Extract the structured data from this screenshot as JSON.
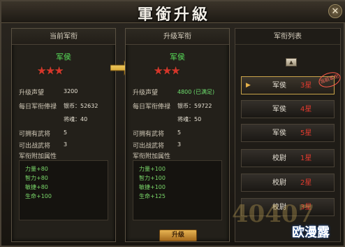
{
  "window": {
    "title": "軍銜升級",
    "close_glyph": "✕"
  },
  "current": {
    "header": "当前军衔",
    "rank": "军侯",
    "stars": "★★★",
    "prestige_label": "升级声望",
    "prestige_value": "3200",
    "salary_label": "每日军衔俸禄",
    "silver": "银币：52632",
    "generals_soul": "将魂：40",
    "max_generals_label": "可拥有武将",
    "max_generals": "5",
    "battle_generals_label": "可出战武将",
    "battle_generals": "3",
    "bonus_label": "军衔附加属性",
    "bonuses": [
      "力量+80",
      "智力+80",
      "敏捷+80",
      "生命+100"
    ]
  },
  "next": {
    "header": "升级军衔",
    "rank": "军侯",
    "stars": "★★★",
    "prestige_label": "升级声望",
    "prestige_value": "4800 (已满足)",
    "salary_label": "每日军衔俸禄",
    "silver": "银币：59722",
    "generals_soul": "将魂：50",
    "max_generals_label": "可拥有武将",
    "max_generals": "5",
    "battle_generals_label": "可出战武将",
    "battle_generals": "3",
    "bonus_label": "军衔附加属性",
    "bonuses": [
      "力量+100",
      "智力+100",
      "敏捷+100",
      "生命+125"
    ]
  },
  "upgrade_button": "升级",
  "rank_list": {
    "header": "军衔列表",
    "scroll_up_glyph": "▲",
    "items": [
      {
        "name": "军侯",
        "level": "3星",
        "selected": true,
        "stamp": "当前军衔"
      },
      {
        "name": "军侯",
        "level": "4星"
      },
      {
        "name": "军侯",
        "level": "5星"
      },
      {
        "name": "校尉",
        "level": "1星"
      },
      {
        "name": "校尉",
        "level": "2星"
      },
      {
        "name": "校尉",
        "level": "3星"
      }
    ]
  },
  "watermark": {
    "number": "40407",
    "text": "欧漫露"
  },
  "colors": {
    "accent_gold": "#e6b24a",
    "stat_green": "#6ee06e",
    "level_red": "#e23a2e"
  }
}
